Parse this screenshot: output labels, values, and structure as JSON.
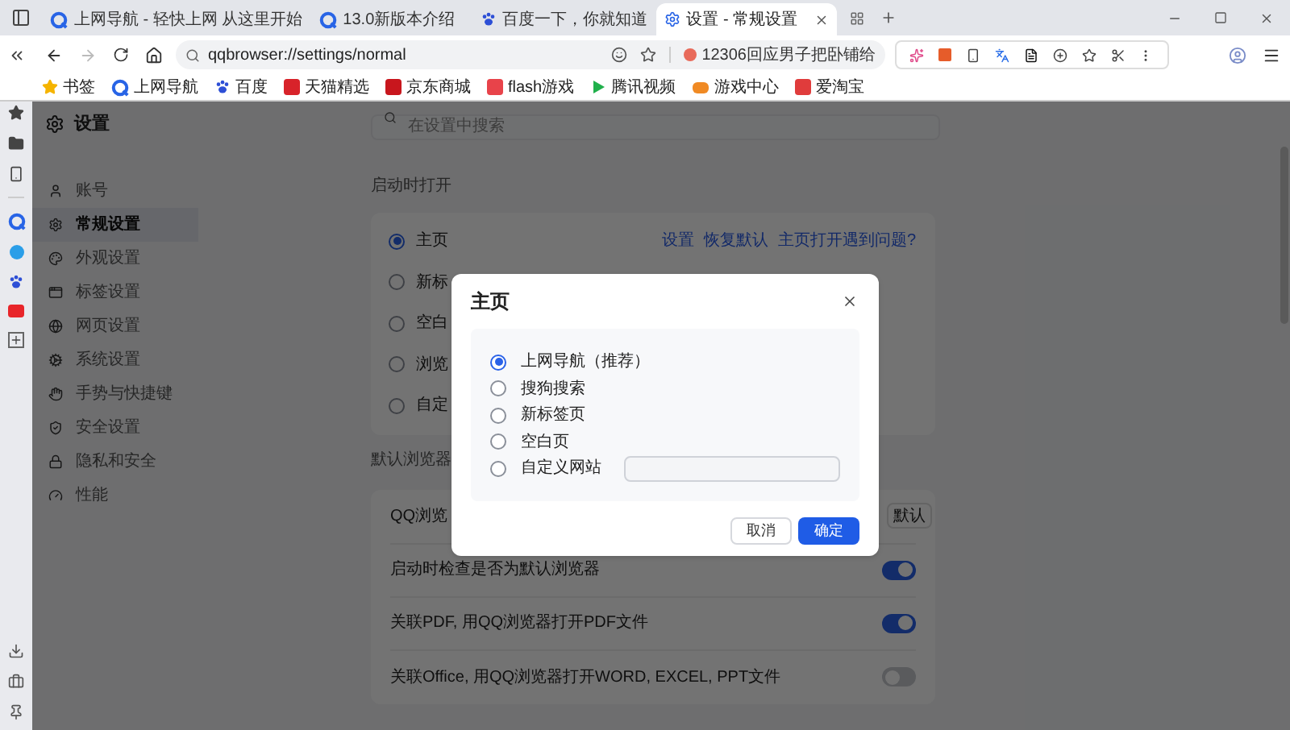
{
  "tab_bar": {
    "tabs": [
      {
        "title": "上网导航 - 轻快上网 从这里开始",
        "selected": false
      },
      {
        "title": "13.0新版本介绍",
        "selected": false
      },
      {
        "title": "百度一下，你就知道",
        "selected": false
      },
      {
        "title": "设置 - 常规设置",
        "selected": true
      }
    ]
  },
  "address_bar": {
    "url": "qqbrowser://settings/normal",
    "news": "12306回应男子把卧铺给"
  },
  "bookmarks": [
    "书签",
    "上网导航",
    "百度",
    "天猫精选",
    "京东商城",
    "flash游戏",
    "腾讯视频",
    "游戏中心",
    "爱淘宝"
  ],
  "settings": {
    "title": "设置",
    "search": {
      "placeholder": "在设置中搜索"
    },
    "sidebar": [
      {
        "label": "账号",
        "selected": false
      },
      {
        "label": "常规设置",
        "selected": true
      },
      {
        "label": "外观设置",
        "selected": false
      },
      {
        "label": "标签设置",
        "selected": false
      },
      {
        "label": "网页设置",
        "selected": false
      },
      {
        "label": "系统设置",
        "selected": false
      },
      {
        "label": "手势与快捷键",
        "selected": false
      },
      {
        "label": "安全设置",
        "selected": false
      },
      {
        "label": "隐私和安全",
        "selected": false
      },
      {
        "label": "性能",
        "selected": false
      }
    ],
    "startup": {
      "heading": "启动时打开",
      "links": [
        "设置",
        "恢复默认",
        "主页打开遇到问题?"
      ],
      "options": [
        {
          "label": "主页",
          "selected": true
        },
        {
          "label": "新标",
          "selected": false
        },
        {
          "label": "空白",
          "selected": false
        },
        {
          "label": "浏览",
          "selected": false
        },
        {
          "label": "自定",
          "selected": false
        }
      ]
    },
    "default_browser": {
      "heading": "默认浏览器",
      "label": "QQ浏览",
      "button": "默认",
      "toggles": [
        {
          "label": "启动时检查是否为默认浏览器",
          "on": true
        },
        {
          "label": "关联PDF, 用QQ浏览器打开PDF文件",
          "on": true
        },
        {
          "label": "关联Office, 用QQ浏览器打开WORD, EXCEL, PPT文件",
          "on": false
        }
      ]
    }
  },
  "dialog": {
    "title": "主页",
    "options": [
      {
        "label": "上网导航（推荐）",
        "selected": true
      },
      {
        "label": "搜狗搜索",
        "selected": false
      },
      {
        "label": "新标签页",
        "selected": false
      },
      {
        "label": "空白页",
        "selected": false
      },
      {
        "label": "自定义网站",
        "selected": false,
        "kind": "custom"
      }
    ],
    "buttons": [
      {
        "label": "取消",
        "kind": "secondary"
      },
      {
        "label": "确定",
        "kind": "primary"
      }
    ]
  }
}
